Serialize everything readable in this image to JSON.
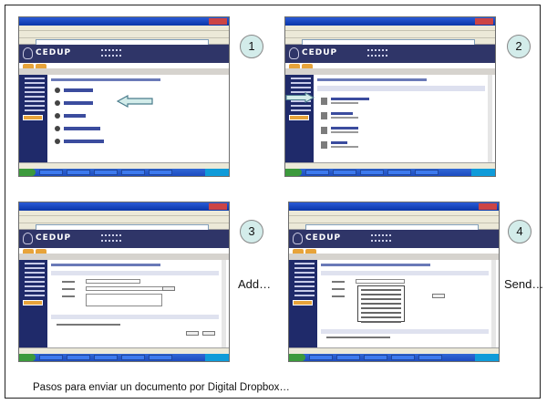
{
  "slide": {
    "steps": [
      {
        "number": "1",
        "side_label": ""
      },
      {
        "number": "2",
        "side_label": ""
      },
      {
        "number": "3",
        "side_label": "Add…"
      },
      {
        "number": "4",
        "side_label": "Send…"
      }
    ],
    "caption": "Pasos para enviar un documento por Digital Dropbox…"
  },
  "app": {
    "logo": "CEDUP"
  },
  "colors": {
    "banner": "#2f3568",
    "sidebar": "#1f2a6a",
    "accent": "#e7a33a",
    "step_circle": "#d3ecea"
  }
}
